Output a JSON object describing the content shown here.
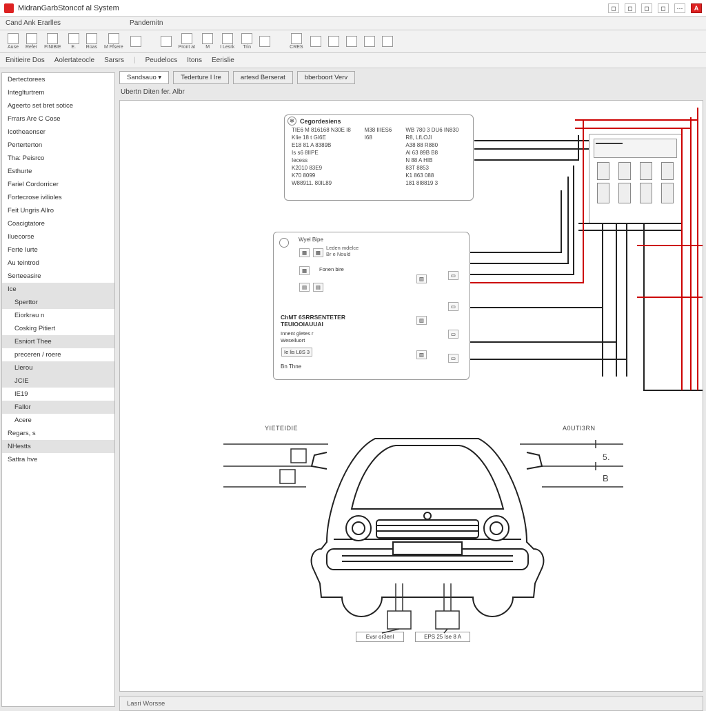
{
  "app": {
    "title": "MidranGarbStoncof al System"
  },
  "window_controls": [
    "◻",
    "◻",
    "◻",
    "◻",
    "⋯"
  ],
  "menu": {
    "item1": "Cand Ank Erarlles",
    "item2": "Pandernitn"
  },
  "toolbar": [
    {
      "label": "Ause"
    },
    {
      "label": "Refer"
    },
    {
      "label": "FINIBIE"
    },
    {
      "label": "E."
    },
    {
      "label": "Roas"
    },
    {
      "label": "M Ffsere"
    },
    {
      "label": ""
    },
    {
      "label": ""
    },
    {
      "label": "Pront at"
    },
    {
      "label": "M"
    },
    {
      "label": "I Lesrk"
    },
    {
      "label": "Trin"
    },
    {
      "label": ""
    },
    {
      "label": "CRES"
    },
    {
      "label": ""
    },
    {
      "label": ""
    },
    {
      "label": ""
    },
    {
      "label": ""
    },
    {
      "label": ""
    }
  ],
  "subnav": [
    "Enitieire Dos",
    "Aolertateocle",
    "Sarsrs",
    "Peudelocs",
    "Itons",
    "Eerislie"
  ],
  "sidebar": [
    {
      "label": "Dertectorees"
    },
    {
      "label": "Integlturtrem"
    },
    {
      "label": "Ageerto set bret sotice"
    },
    {
      "label": "Frrars Are C Cose"
    },
    {
      "label": "Icotheaonser"
    },
    {
      "label": "Perterterton"
    },
    {
      "label": "Tha: Peisrco"
    },
    {
      "label": "Esthurte"
    },
    {
      "label": "Fariel Cordorricer"
    },
    {
      "label": "Fortecrose ivilioles"
    },
    {
      "label": "Feit Ungris Allro"
    },
    {
      "label": "Coacigtatore"
    },
    {
      "label": "Iluecorse"
    },
    {
      "label": "Ferte Iurte"
    },
    {
      "label": "Au teintrod"
    },
    {
      "label": "Serteeasire"
    },
    {
      "label": "Ice",
      "shaded": true
    },
    {
      "label": "Sperttor",
      "indent": true,
      "shaded": true
    },
    {
      "label": "Eiorkrau n",
      "indent": true
    },
    {
      "label": "Coskirg Pitiert",
      "indent": true
    },
    {
      "label": "Esniort Thee",
      "indent": true,
      "shaded": true
    },
    {
      "label": "preceren / roere",
      "indent": true
    },
    {
      "label": "Llerou",
      "indent": true,
      "shaded": true
    },
    {
      "label": "JCIE",
      "indent": true,
      "shaded": true
    },
    {
      "label": "IE19",
      "indent": true
    },
    {
      "label": "Fallor",
      "indent": true,
      "shaded": true
    },
    {
      "label": "Acere",
      "indent": true
    },
    {
      "label": "Regars, s"
    },
    {
      "label": "NHestts",
      "shaded": true
    },
    {
      "label": "Sattra hve"
    }
  ],
  "viewTabs": [
    {
      "label": "Sandsauo ▾",
      "active": true
    },
    {
      "label": "Tederture l Ire"
    },
    {
      "label": "artesd Berserat"
    },
    {
      "label": "bberboort Verv"
    }
  ],
  "crumb": "Ubertn Diten fer. Albr",
  "panel1": {
    "title": "Cegordesiens",
    "left": [
      "TIE6 M 816168 N30E I8",
      "KIie 18 t GI6E",
      "E18 81 A 8389B",
      "Is s6 8IIPE",
      "Iecess",
      "",
      " K2010 83E9",
      "K70 8099",
      "W88911. 80IL89"
    ],
    "mid": [
      "M38 IIIES6",
      "I68",
      "",
      "",
      "",
      "",
      " ",
      " ",
      " "
    ],
    "right": [
      "WB 780 3 DU6 IN830",
      "R8, LfLOJl",
      "",
      "A38 88 R880",
      "Al 63 89B  B8",
      "N 88 A HIB",
      "",
      "83T 8853",
      "K1 863 088",
      "181 8I8819 3"
    ]
  },
  "panel2": {
    "title": "Wyel Bipe",
    "sub": [
      "Leden mdelce",
      "Br e Nould",
      "",
      "Fonen bire"
    ],
    "caption1": "ChMT 6SRRSENTETER",
    "caption2": "TEUIOOIAUUAI",
    "caption3": "Innent gletes r",
    "caption4": "Weseiluort",
    "row": "Ie lis L8S 3",
    "footer": "Bn Thne"
  },
  "vehicle": {
    "label_left": "YIETEIDIE",
    "label_right": "A0UTI3RN",
    "tick_r1": "5.",
    "tick_r2": "B",
    "conn1": "Evsr or3enl",
    "conn2": "EPS 25 Ise 8 A"
  },
  "status": "Lasri Worsse"
}
